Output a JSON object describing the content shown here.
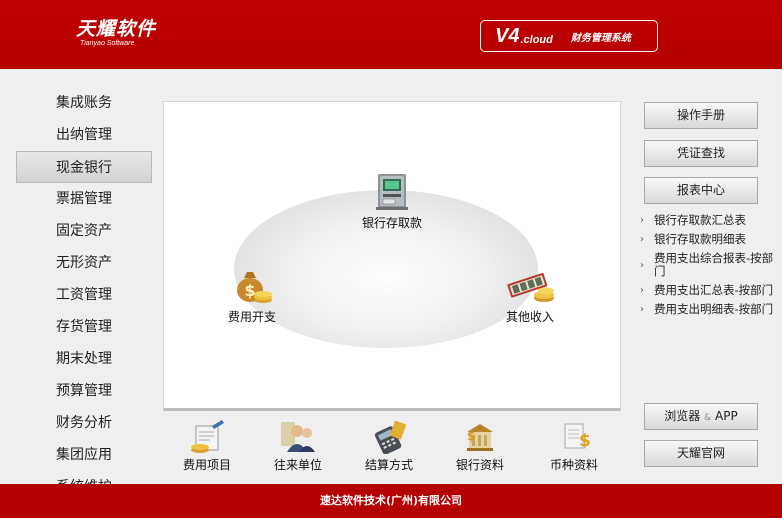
{
  "header": {
    "logo_cn": "天耀软件",
    "logo_en": "Tianyao Software",
    "version": "V4",
    "version_suffix": ".cloud",
    "system_name": "财务管理系统"
  },
  "nav": {
    "items": [
      {
        "label": "集成账务"
      },
      {
        "label": "出纳管理"
      },
      {
        "label": "现金银行",
        "active": true
      },
      {
        "label": "票据管理"
      },
      {
        "label": "固定资产"
      },
      {
        "label": "无形资产"
      },
      {
        "label": "工资管理"
      },
      {
        "label": "存货管理"
      },
      {
        "label": "期末处理"
      },
      {
        "label": "预算管理"
      },
      {
        "label": "财务分析"
      },
      {
        "label": "集团应用"
      },
      {
        "label": "系统维护"
      }
    ]
  },
  "diagram": {
    "nodes": {
      "bank_deposit": {
        "label": "银行存取款",
        "icon": "atm-icon"
      },
      "expense": {
        "label": "费用开支",
        "icon": "money-bag-icon"
      },
      "other_income": {
        "label": "其他收入",
        "icon": "cash-stack-icon"
      }
    }
  },
  "shortcuts": [
    {
      "label": "费用项目",
      "icon": "invoice-pen-icon"
    },
    {
      "label": "往来单位",
      "icon": "people-icon"
    },
    {
      "label": "结算方式",
      "icon": "card-reader-icon"
    },
    {
      "label": "银行资料",
      "icon": "bank-icon"
    },
    {
      "label": "币种资料",
      "icon": "currency-doc-icon"
    }
  ],
  "right": {
    "manual": "操作手册",
    "voucher_search": "凭证查找",
    "report_center": "报表中心",
    "reports": [
      {
        "label": "银行存取款汇总表"
      },
      {
        "label": "银行存取款明细表"
      },
      {
        "label": "费用支出综合报表-按部门"
      },
      {
        "label": "费用支出汇总表-按部门"
      },
      {
        "label": "费用支出明细表-按部门"
      }
    ],
    "browser_app_a": "浏览器",
    "browser_app_amp": "&",
    "browser_app_b": "APP",
    "website": "天耀官网"
  },
  "footer": {
    "company": "速达软件技术(广州)有限公司"
  }
}
